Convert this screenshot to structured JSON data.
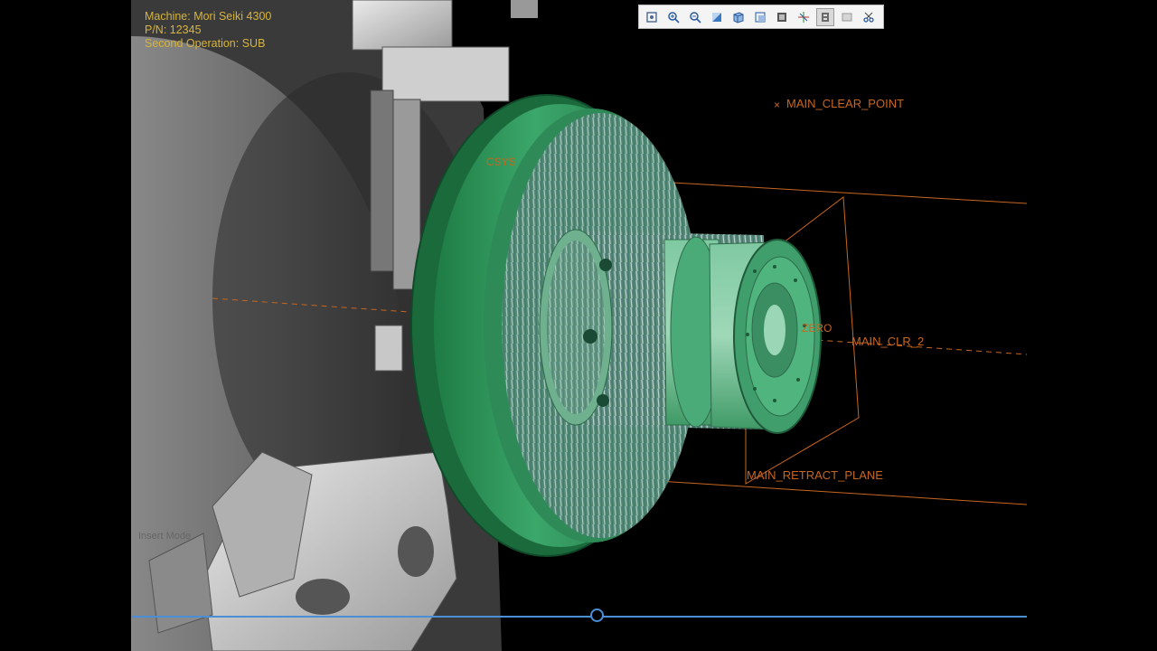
{
  "info": {
    "machine": "Machine: Mori Seiki 4300",
    "pn": "P/N: 12345",
    "operation": "Second Operation: SUB"
  },
  "labels": {
    "clear_point": "MAIN_CLEAR_POINT",
    "csys": "CSYS",
    "zero": "ZERO",
    "clr_plane": "MAIN_CLR_2",
    "retract_plane": "MAIN_RETRACT_PLANE"
  },
  "mode_text": "Insert Mode",
  "toolbar": {
    "icons": [
      "zoom-fit-icon",
      "zoom-in-icon",
      "zoom-out-icon",
      "shade-icon",
      "box-view-icon",
      "view-icon",
      "render-icon",
      "spin-center-icon",
      "datum-display-icon",
      "saved-views-icon",
      "cut-icon"
    ],
    "active_index": 8
  },
  "playback": {
    "progress": 0.52
  },
  "colors": {
    "part_green": "#2f9c62",
    "label_orange": "#c8661e",
    "info_yellow": "#d8b43a",
    "slider_blue": "#4a8fd6"
  }
}
